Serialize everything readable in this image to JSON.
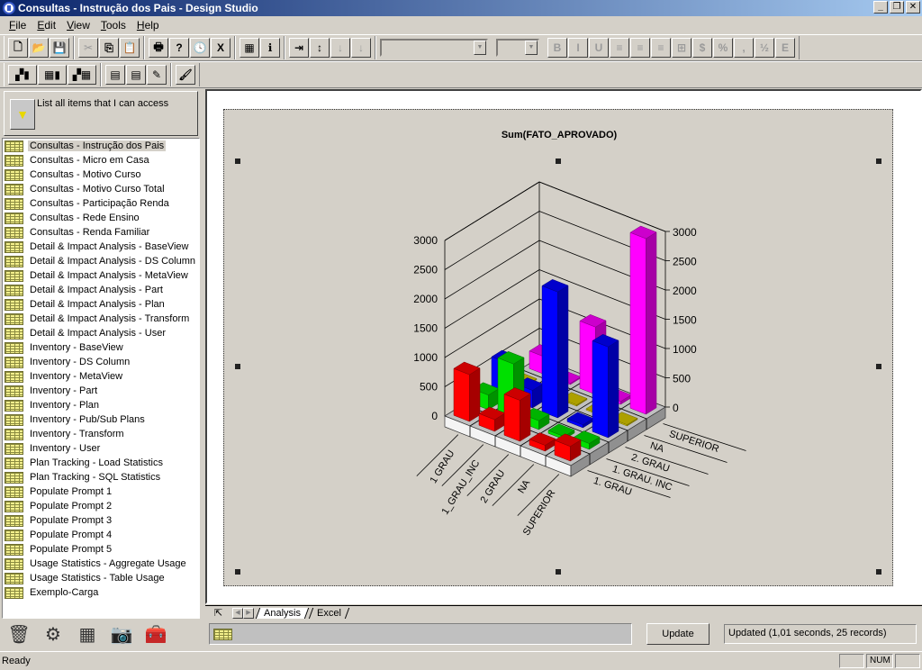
{
  "window": {
    "title": "Consultas - Instrução dos Pais - Design Studio",
    "buttons": [
      "_",
      "❐",
      "✕"
    ]
  },
  "menu": [
    {
      "label": "File",
      "mnemonic": "F",
      "rest": "ile"
    },
    {
      "label": "Edit",
      "mnemonic": "E",
      "rest": "dit"
    },
    {
      "label": "View",
      "mnemonic": "V",
      "rest": "iew"
    },
    {
      "label": "Tools",
      "mnemonic": "T",
      "rest": "ools"
    },
    {
      "label": "Help",
      "mnemonic": "H",
      "rest": "elp"
    }
  ],
  "toolbar1": {
    "groups": [
      [
        {
          "icon": "new-icon",
          "glyph": "🗋"
        },
        {
          "icon": "open-icon",
          "glyph": "📂"
        },
        {
          "icon": "save-icon",
          "glyph": "💾"
        }
      ],
      [
        {
          "icon": "cut-icon",
          "glyph": "✂",
          "disabled": true
        },
        {
          "icon": "copy-icon",
          "glyph": "⎘"
        },
        {
          "icon": "paste-icon",
          "glyph": "📋",
          "disabled": true
        }
      ],
      [
        {
          "icon": "print-icon",
          "glyph": "🖶"
        },
        {
          "icon": "help-icon",
          "glyph": "?"
        },
        {
          "icon": "clock-icon",
          "glyph": "🕓"
        },
        {
          "icon": "excel-icon",
          "glyph": "X"
        }
      ],
      [
        {
          "icon": "calculator-icon",
          "glyph": "▦"
        },
        {
          "icon": "info-icon",
          "glyph": "ℹ"
        }
      ],
      [
        {
          "icon": "pivot-icon",
          "glyph": "⇥"
        },
        {
          "icon": "sort-icon",
          "glyph": "↕"
        },
        {
          "icon": "sort-ascending-icon",
          "glyph": "↓",
          "disabled": true
        },
        {
          "icon": "sort-descending-icon",
          "glyph": "↓",
          "disabled": true
        }
      ]
    ],
    "font_combo_value": "",
    "size_combo_value": "",
    "format_buttons": [
      {
        "icon": "bold-icon",
        "glyph": "B"
      },
      {
        "icon": "italic-icon",
        "glyph": "I"
      },
      {
        "icon": "underline-icon",
        "glyph": "U"
      },
      {
        "icon": "align-left-icon",
        "glyph": "≡"
      },
      {
        "icon": "align-center-icon",
        "glyph": "≡"
      },
      {
        "icon": "align-right-icon",
        "glyph": "≡"
      },
      {
        "icon": "merge-icon",
        "glyph": "⊞"
      },
      {
        "icon": "currency-icon",
        "glyph": "$"
      },
      {
        "icon": "percent-icon",
        "glyph": "%"
      },
      {
        "icon": "comma-icon",
        "glyph": ","
      },
      {
        "icon": "fraction-icon",
        "glyph": "½"
      },
      {
        "icon": "exponent-icon",
        "glyph": "E"
      }
    ]
  },
  "toolbar2": {
    "buttons": [
      {
        "icon": "chart-wizard-icon",
        "glyph": "▞▮"
      },
      {
        "icon": "table-to-chart-icon",
        "glyph": "▦▮"
      },
      {
        "icon": "chart-to-table-icon",
        "glyph": "▞▦"
      },
      {
        "icon": "new-report-icon",
        "glyph": "▤"
      },
      {
        "icon": "new-report-2-icon",
        "glyph": "▤"
      },
      {
        "icon": "edit-report-icon",
        "glyph": "✎"
      },
      {
        "icon": "paint-icon",
        "glyph": "🖌"
      }
    ]
  },
  "left_panel": {
    "list_all_label": "List all items that I can access",
    "items": [
      "Consultas - Instrução dos Pais",
      "Consultas - Micro em Casa",
      "Consultas - Motivo Curso",
      "Consultas - Motivo Curso Total",
      "Consultas - Participação Renda",
      "Consultas - Rede Ensino",
      "Consultas - Renda Familiar",
      "Detail & Impact Analysis - BaseView",
      "Detail & Impact Analysis - DS Column",
      "Detail & Impact Analysis - MetaView",
      "Detail & Impact Analysis - Part",
      "Detail & Impact Analysis - Plan",
      "Detail & Impact Analysis - Transform",
      "Detail & Impact Analysis - User",
      "Inventory - BaseView",
      "Inventory - DS Column",
      "Inventory - MetaView",
      "Inventory - Part",
      "Inventory - Plan",
      "Inventory - Pub/Sub Plans",
      "Inventory - Transform",
      "Inventory - User",
      "Plan Tracking - Load Statistics",
      "Plan Tracking - SQL Statistics",
      "Populate Prompt 1",
      "Populate Prompt 2",
      "Populate Prompt 3",
      "Populate Prompt 4",
      "Populate Prompt 5",
      "Usage Statistics - Aggregate Usage",
      "Usage Statistics - Table Usage",
      "Exemplo-Carga"
    ],
    "selected_index": 0,
    "bottom_icons": [
      {
        "icon": "trash-icon",
        "glyph": "🗑"
      },
      {
        "icon": "settings-gear-icon",
        "glyph": "⚙"
      },
      {
        "icon": "table-icon",
        "glyph": "▦"
      },
      {
        "icon": "camera-icon",
        "glyph": "📷"
      },
      {
        "icon": "toolbox-icon",
        "glyph": "🧰"
      }
    ]
  },
  "tabs": [
    {
      "label": "Analysis",
      "active": true
    },
    {
      "label": "Excel",
      "active": false
    }
  ],
  "bottom": {
    "update_label": "Update",
    "update_status": "Updated (1,01 seconds, 25 records)"
  },
  "status": {
    "ready": "Ready",
    "panes": [
      "",
      "NUM",
      ""
    ]
  },
  "chart_data": {
    "type": "bar",
    "subtype": "3d-grouped-depth",
    "title": "Sum(FATO_APROVADO)",
    "categories": [
      "1_GRAU",
      "1_GRAU_INC",
      "2_GRAU",
      "NA",
      "SUPERIOR"
    ],
    "series": [
      {
        "name": "1. GRAU",
        "color": "#ff0000",
        "values": [
          800,
          200,
          700,
          100,
          250
        ]
      },
      {
        "name": "1. GRAU. INC",
        "color": "#00e000",
        "values": [
          250,
          950,
          150,
          50,
          100
        ]
      },
      {
        "name": "2. GRAU",
        "color": "#0000ff",
        "values": [
          600,
          300,
          2150,
          50,
          1550
        ]
      },
      {
        "name": "NA",
        "color": "#d8c800",
        "values": [
          10,
          10,
          10,
          10,
          10
        ]
      },
      {
        "name": "SUPERIOR",
        "color": "#ff00ff",
        "values": [
          300,
          0,
          1150,
          50,
          3000
        ]
      }
    ],
    "z_ticks": [
      0,
      500,
      1000,
      1500,
      2000,
      2500,
      3000
    ],
    "ylim": [
      0,
      3000
    ],
    "grid": true,
    "legend": "none"
  }
}
